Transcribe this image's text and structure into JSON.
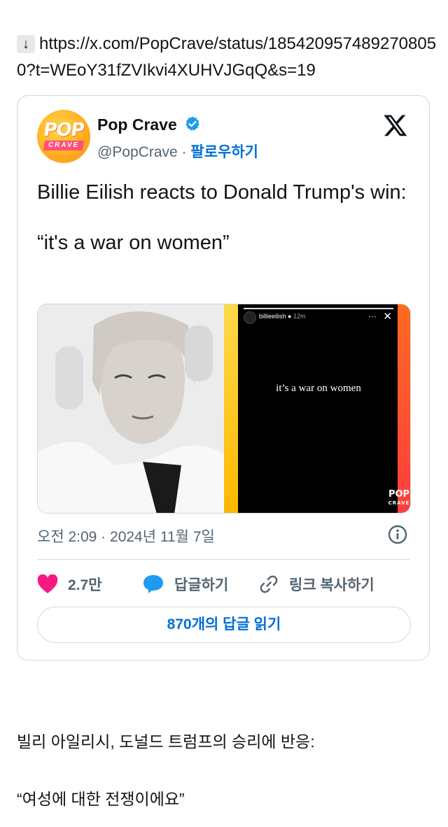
{
  "link": {
    "arrow": "↓",
    "url": "https://x.com/PopCrave/status/1854209574892708050?t=WEoY31fZVIkvi4XUHVJGqQ&s=19"
  },
  "tweet": {
    "avatar_top": "POP",
    "avatar_bottom": "CRAVE",
    "author_name": "Pop Crave",
    "handle": "@PopCrave",
    "separator": " · ",
    "follow_label": "팔로우하기",
    "text_line1": "Billie Eilish reacts to Donald Trump's win:",
    "text_quote": "“it's a war on women”",
    "story": {
      "username": "billieeilish",
      "time": "12m",
      "more": "···",
      "close": "✕",
      "caption": "it’s a war on women",
      "logo_top": "POP",
      "logo_bottom": "CRAVE"
    },
    "timestamp": "오전 2:09 · 2024년 11월 7일",
    "like_count": "2.7만",
    "reply_label": "답글하기",
    "copy_link_label": "링크 복사하기",
    "read_replies_label": "870개의 답글 읽기"
  },
  "translation": {
    "line1": "빌리 아일리시, 도널드 트럼프의 승리에 반응:",
    "line2": "“여성에 대한 전쟁이에요”"
  },
  "colors": {
    "accent_blue": "#006fd6",
    "like_pink": "#f91880",
    "reply_blue": "#1d9bf0",
    "secondary_text": "#536471",
    "border": "#cfd9de"
  }
}
